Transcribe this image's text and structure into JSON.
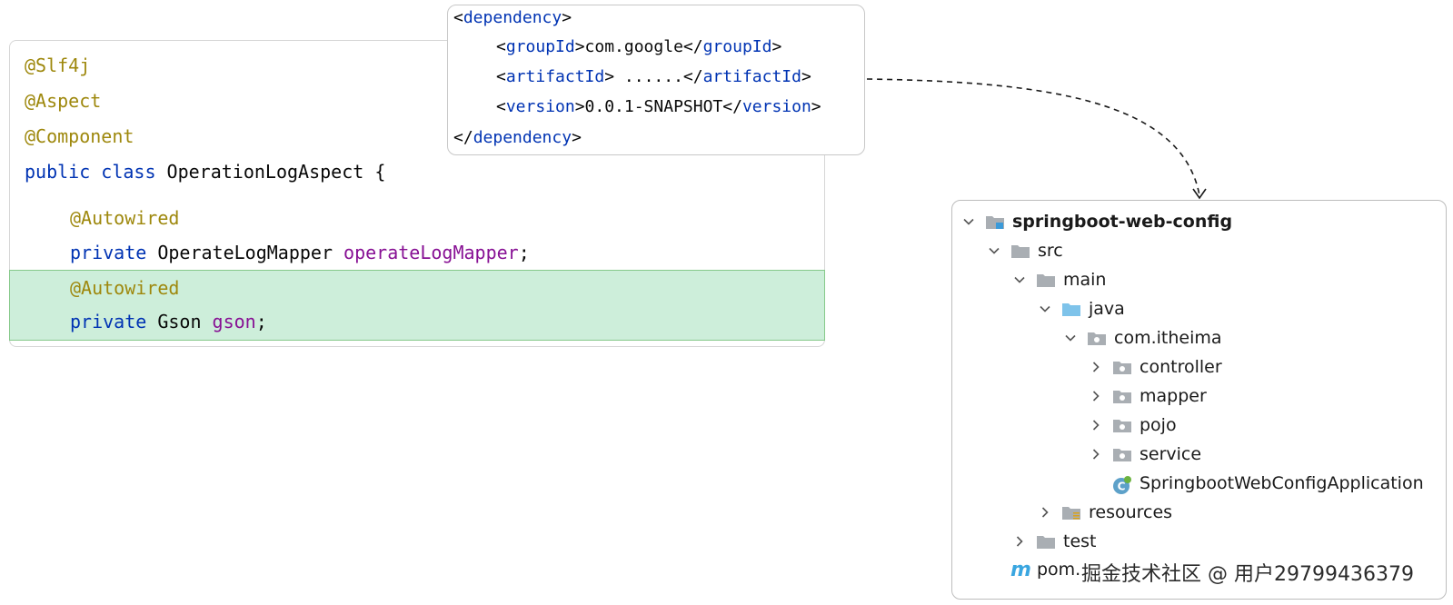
{
  "code": {
    "lines": [
      {
        "segments": [
          {
            "cls": "ann",
            "text": "@Slf4j"
          }
        ]
      },
      {
        "segments": [
          {
            "cls": "ann",
            "text": "@Aspect"
          }
        ]
      },
      {
        "segments": [
          {
            "cls": "ann",
            "text": "@Component"
          }
        ]
      },
      {
        "segments": [
          {
            "cls": "kw",
            "text": "public class "
          },
          {
            "cls": "plain",
            "text": "OperationLogAspect {"
          }
        ]
      },
      {
        "segments": [
          {
            "cls": "ann",
            "text": "@Autowired"
          }
        ]
      },
      {
        "segments": [
          {
            "cls": "kw",
            "text": "private "
          },
          {
            "cls": "plain",
            "text": "OperateLogMapper "
          },
          {
            "cls": "field",
            "text": "operateLogMapper"
          },
          {
            "cls": "plain",
            "text": ";"
          }
        ]
      },
      {
        "segments": [
          {
            "cls": "ann",
            "text": "@Autowired"
          }
        ]
      },
      {
        "segments": [
          {
            "cls": "kw",
            "text": "private "
          },
          {
            "cls": "plain",
            "text": "Gson "
          },
          {
            "cls": "field",
            "text": "gson"
          },
          {
            "cls": "plain",
            "text": ";"
          }
        ]
      }
    ]
  },
  "xml": {
    "lines": [
      {
        "segments": [
          {
            "cls": "plain",
            "text": "<"
          },
          {
            "cls": "tag",
            "text": "dependency"
          },
          {
            "cls": "plain",
            "text": ">"
          }
        ]
      },
      {
        "segments": [
          {
            "cls": "plain",
            "text": "<"
          },
          {
            "cls": "tag",
            "text": "groupId"
          },
          {
            "cls": "plain",
            "text": ">com.google</"
          },
          {
            "cls": "tag",
            "text": "groupId"
          },
          {
            "cls": "plain",
            "text": ">"
          }
        ]
      },
      {
        "segments": [
          {
            "cls": "plain",
            "text": "<"
          },
          {
            "cls": "tag",
            "text": "artifactId"
          },
          {
            "cls": "plain",
            "text": "> ......</"
          },
          {
            "cls": "tag",
            "text": "artifactId"
          },
          {
            "cls": "plain",
            "text": ">"
          }
        ]
      },
      {
        "segments": [
          {
            "cls": "plain",
            "text": "<"
          },
          {
            "cls": "tag",
            "text": "version"
          },
          {
            "cls": "plain",
            "text": ">0.0.1-SNAPSHOT</"
          },
          {
            "cls": "tag",
            "text": "version"
          },
          {
            "cls": "plain",
            "text": ">"
          }
        ]
      },
      {
        "segments": [
          {
            "cls": "plain",
            "text": "</"
          },
          {
            "cls": "tag",
            "text": "dependency"
          },
          {
            "cls": "plain",
            "text": ">"
          }
        ]
      }
    ]
  },
  "tree": {
    "items": [
      {
        "label": "springboot-web-config",
        "chevron": "down",
        "icon": "module-folder-icon",
        "bold": true
      },
      {
        "label": "src",
        "chevron": "down",
        "icon": "folder-icon"
      },
      {
        "label": "main",
        "chevron": "down",
        "icon": "folder-icon"
      },
      {
        "label": "java",
        "chevron": "down",
        "icon": "source-folder-icon"
      },
      {
        "label": "com.itheima",
        "chevron": "down",
        "icon": "package-icon"
      },
      {
        "label": "controller",
        "chevron": "right",
        "icon": "package-icon"
      },
      {
        "label": "mapper",
        "chevron": "right",
        "icon": "package-icon"
      },
      {
        "label": "pojo",
        "chevron": "right",
        "icon": "package-icon"
      },
      {
        "label": "service",
        "chevron": "right",
        "icon": "package-icon"
      },
      {
        "label": "SpringbootWebConfigApplication",
        "chevron": "none",
        "icon": "spring-class-icon"
      },
      {
        "label": "resources",
        "chevron": "right",
        "icon": "resources-folder-icon"
      },
      {
        "label": "test",
        "chevron": "right",
        "icon": "folder-icon"
      },
      {
        "label": "pom.",
        "chevron": "none",
        "icon": "maven-icon"
      }
    ]
  },
  "watermark": "掘金技术社区 @ 用户29799436379"
}
